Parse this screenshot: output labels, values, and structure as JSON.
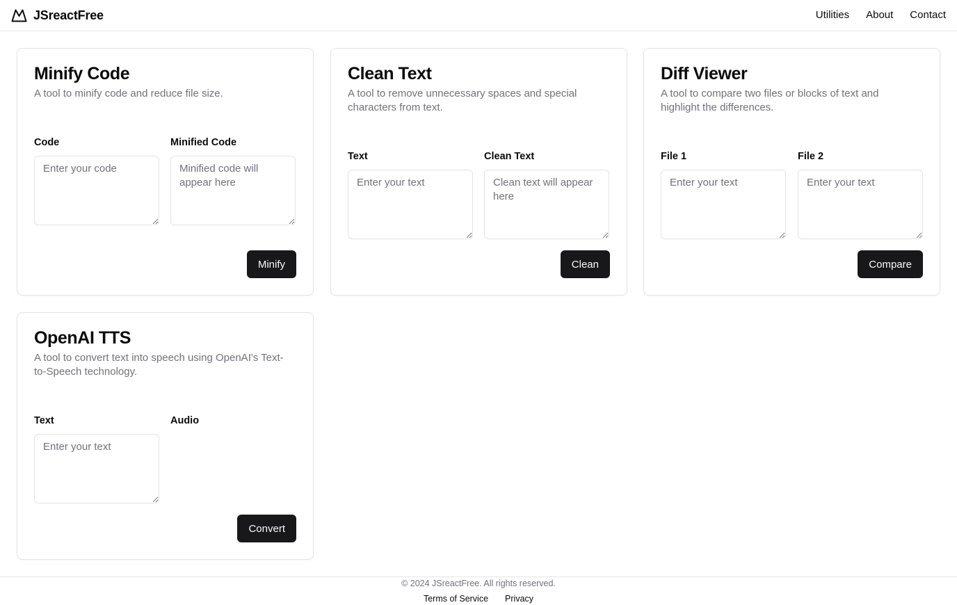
{
  "header": {
    "brand": "JSreactFree",
    "brand_icon": "mountain-icon",
    "nav": [
      "Utilities",
      "About",
      "Contact"
    ]
  },
  "cards": [
    {
      "title": "Minify Code",
      "description": "A tool to minify code and reduce file size.",
      "input_label": "Code",
      "input_placeholder": "Enter your code",
      "output_label": "Minified Code",
      "output_placeholder": "Minified code will appear here",
      "button": "Minify"
    },
    {
      "title": "Clean Text",
      "description": "A tool to remove unnecessary spaces and special characters from text.",
      "input_label": "Text",
      "input_placeholder": "Enter your text",
      "output_label": "Clean Text",
      "output_placeholder": "Clean text will appear here",
      "button": "Clean"
    },
    {
      "title": "Diff Viewer",
      "description": "A tool to compare two files or blocks of text and highlight the differences.",
      "input_label": "File 1",
      "input_placeholder": "Enter your text",
      "output_label": "File 2",
      "output_placeholder": "Enter your text",
      "button": "Compare"
    },
    {
      "title": "OpenAI TTS",
      "description": "A tool to convert text into speech using OpenAI's Text-to-Speech technology.",
      "input_label": "Text",
      "input_placeholder": "Enter your text",
      "output_label": "Audio",
      "button": "Convert"
    }
  ],
  "footer": {
    "copyright": "© 2024 JSreactFree. All rights reserved.",
    "links": [
      "Terms of Service",
      "Privacy"
    ]
  },
  "colors": {
    "primary_button": "#18181b",
    "muted_text": "#71717a",
    "border": "#e4e4e7"
  }
}
